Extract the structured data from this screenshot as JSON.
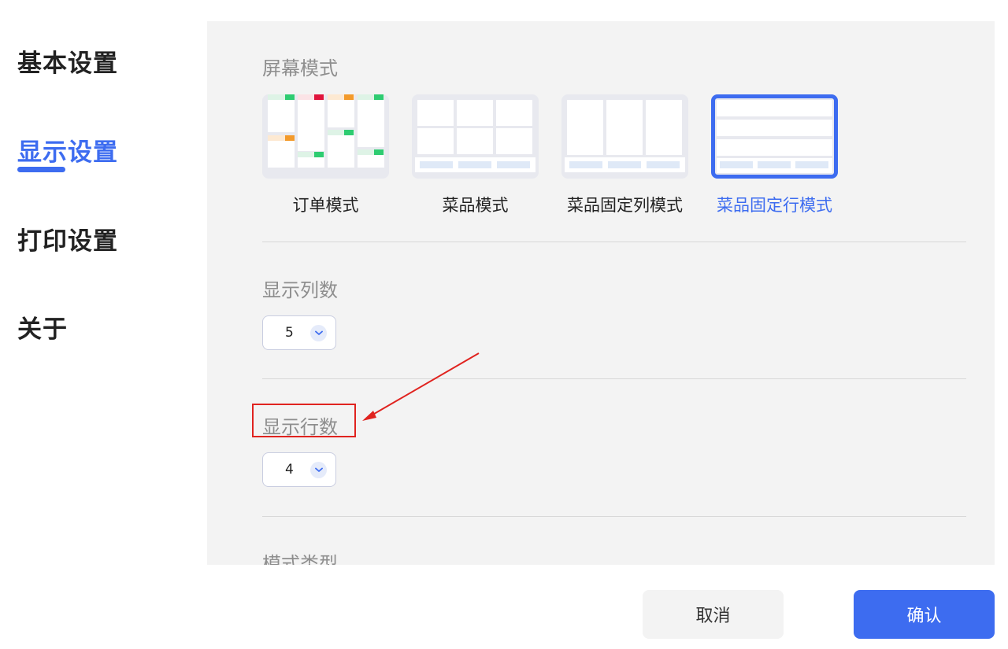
{
  "sidebar": {
    "items": [
      {
        "label": "基本设置",
        "active": false
      },
      {
        "label": "显示设置",
        "active": true
      },
      {
        "label": "打印设置",
        "active": false
      },
      {
        "label": "关于",
        "active": false
      }
    ]
  },
  "screen_mode": {
    "title": "屏幕模式",
    "options": [
      {
        "label": "订单模式",
        "selected": false
      },
      {
        "label": "菜品模式",
        "selected": false
      },
      {
        "label": "菜品固定列模式",
        "selected": false
      },
      {
        "label": "菜品固定行模式",
        "selected": true
      }
    ]
  },
  "columns": {
    "title": "显示列数",
    "value": "5"
  },
  "rows": {
    "title": "显示行数",
    "value": "4"
  },
  "mode_type": {
    "title": "模式类型"
  },
  "footer": {
    "cancel_label": "取消",
    "confirm_label": "确认"
  },
  "colors": {
    "accent": "#3d6cf0",
    "annotation": "#e0231f"
  },
  "icons": {
    "select_chevron": "chevron-down-icon"
  }
}
